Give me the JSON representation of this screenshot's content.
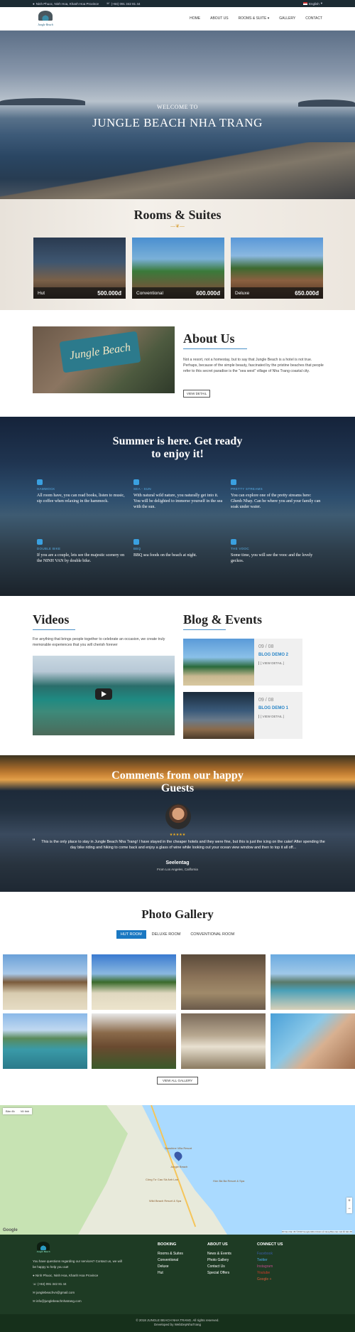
{
  "topbar": {
    "address": "Ninh Phuoc, Ninh Hoa, Khanh Hoa Province",
    "phone": "(+84) 091 342 81 44",
    "language": "English"
  },
  "nav": {
    "logo_text": "Jungle Beach",
    "items": [
      "HOME",
      "ABOUT US",
      "ROOMS & SUITE ▾",
      "GALLERY",
      "CONTACT"
    ]
  },
  "hero": {
    "welcome": "WELCOME TO",
    "title": "JUNGLE BEACH NHA TRANG"
  },
  "rooms": {
    "title": "Rooms & Suites",
    "items": [
      {
        "name": "Hut",
        "price": "500.000đ"
      },
      {
        "name": "Conventional",
        "price": "600.000đ"
      },
      {
        "name": "Deluxe",
        "price": "650.000đ"
      }
    ]
  },
  "about": {
    "sign": "Jungle Beach",
    "title": "About Us",
    "text": "Not a resort, not a homestay, but to say that Jungle Beach is a hotel is not true. Perhaps, because of the simple beauty, fascinated by the pristine beaches that people refer to this secret paradise is the \"sea west\" village of Nha Trang coastal city.",
    "button": "VIEW DETAIL"
  },
  "summer": {
    "title_line1": "Summer is here. Get ready",
    "title_line2": "to enjoy it!",
    "features": [
      {
        "heading": "HAMMOCK",
        "text": "All room have, you can read books, listen to music, sip coffee when relaxing in the hammock.",
        "icon": "hammock-icon"
      },
      {
        "heading": "SEA - SUN",
        "text": "With natural wild nature, you naturally get into it. You will be delighted to immerse yourself in the sea with the sun.",
        "icon": "sun-icon"
      },
      {
        "heading": "PRETTY STREAMS",
        "text": "You can explore one of the pretty streams here: Ghenh Nhay. Can be where you and your family can soak under water.",
        "icon": "picture-icon"
      },
      {
        "heading": "DOUBLE BIKE",
        "text": "If you are a couple, lets see the majestic scenery on the NINH VAN by double bike.",
        "icon": "bicycle-icon"
      },
      {
        "heading": "BBQ",
        "text": "BBQ sea foods on the beach at night.",
        "icon": "cutlery-icon"
      },
      {
        "heading": "THE VOOC",
        "text": "Some time, you will see the vooc and the lovely geckos.",
        "icon": "paw-icon"
      }
    ]
  },
  "videos": {
    "title": "Videos",
    "text": "For anything that brings people together to celebrate an occasion, we create truly memorable experiences that you will cherish forever"
  },
  "blog": {
    "title": "Blog & Events",
    "posts": [
      {
        "date": "09 / 08",
        "name": "BLOG DEMO 2",
        "more": "[ VIEW DETAIL ]"
      },
      {
        "date": "09 / 08",
        "name": "BLOG DEMO 1",
        "more": "[ VIEW DETAIL ]"
      }
    ]
  },
  "comments": {
    "title_line1": "Comments from our happy",
    "title_line2": "Guests",
    "stars": "★★★★★",
    "quote": "This is the only place to stay in Jungle Beach Nha Trang! I have stayed in the cheaper hotels and they were fine, but this is just the icing on the cake! After spending the day bike riding and hiking to come back and enjoy a glass of wine while looking out your ocean view window and then to top it all off...",
    "name": "Seelentag",
    "from": "From Los Angeles, California"
  },
  "gallery": {
    "title": "Photo Gallery",
    "tabs": [
      "HUT ROOM",
      "DELUXE ROOM",
      "CONVENTIONAL ROOM"
    ],
    "button": "VIEW ALL GALLERY"
  },
  "map": {
    "controls": [
      "Bản đồ",
      "Vệ tinh"
    ],
    "labels": [
      "Sunshine Villa Resort",
      "Jungle Beach",
      "Công Tư Cau Sả Anh Lan",
      "Hòn Bà Ba Resort & Spa",
      "Wild Beach Resort & Spa"
    ],
    "google": "Google",
    "footer_note": "Dữ liệu bản đồ ©2018 Google   Điều khoản sử dụng   Báo cáo một lỗi bản đồ"
  },
  "footer": {
    "logo_text": "Jungle Beach",
    "desc": "You have questions regarding our services? Contact us, we will be happy to help you out!",
    "address": "Ninh Phuoc, Ninh Hoa, Khanh Hoa Province",
    "phone": "(+84) 091 342 81 44",
    "email1": "junglebeachvn@gmail.com",
    "email2": "info@junglebeachnhatrang.com",
    "booking": {
      "title": "BOOKING",
      "items": [
        "Rooms & Suites",
        "Conventional",
        "Deluxe",
        "Hut"
      ]
    },
    "about": {
      "title": "ABOUT US",
      "items": [
        "News & Events",
        "Photo Gallery",
        "Contact Us",
        "Special Offers"
      ]
    },
    "connect": {
      "title": "CONNECT US",
      "items": [
        "Facebook",
        "Twitter",
        "Instagram",
        "Youtube",
        "Google +"
      ]
    },
    "copyright": "© 2018 JUNGLE BEACH NHA TRANG. All rights reserved.",
    "developer": "Developed by WebDepNhaTrang"
  },
  "colors": {
    "accent": "#1a78c2",
    "footer": "#1e3b24",
    "gold": "#d9a441"
  }
}
